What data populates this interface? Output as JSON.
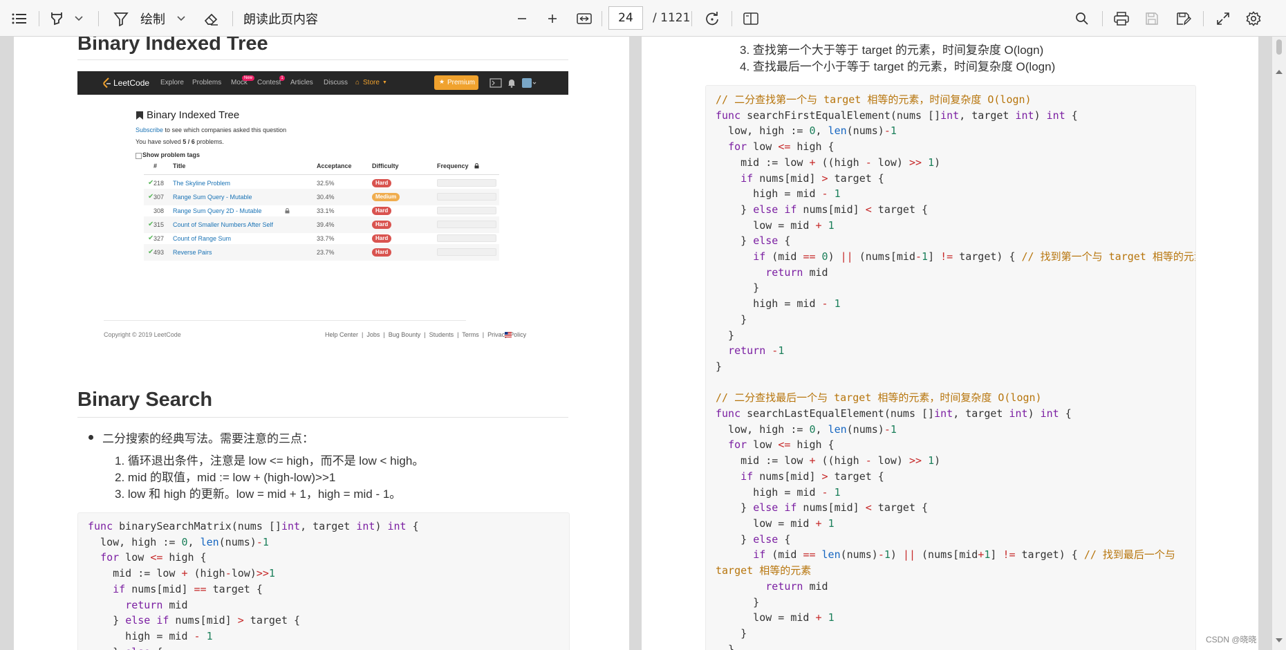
{
  "toolbar": {
    "draw_label": "绘制",
    "read_aloud_label": "朗读此页内容",
    "current_page": "24",
    "total_pages": "/ 1121"
  },
  "left_page": {
    "heading_bit": "Binary Indexed Tree",
    "leetcode": {
      "logo": "LeetCode",
      "nav": [
        "Explore",
        "Problems",
        "Mock",
        "Contest",
        "Articles",
        "Discuss",
        "Store"
      ],
      "mock_badge": "New",
      "contest_badge": "1",
      "premium": "Premium",
      "tag_title": "Binary Indexed Tree",
      "subscribe_link": "Subscribe",
      "subscribe_rest": "to see which companies asked this question",
      "solved_prefix": "You have solved",
      "solved_count": "5 / 6",
      "solved_suffix": "problems.",
      "show_tags": "Show problem tags",
      "columns": [
        "#",
        "Title",
        "Acceptance",
        "Difficulty",
        "Frequency"
      ],
      "rows": [
        {
          "solved": true,
          "num": "218",
          "title": "The Skyline Problem",
          "acceptance": "32.5%",
          "difficulty": "Hard",
          "color": "#d9534f"
        },
        {
          "solved": true,
          "num": "307",
          "title": "Range Sum Query - Mutable",
          "acceptance": "30.4%",
          "difficulty": "Medium",
          "color": "#f0ad4e"
        },
        {
          "solved": false,
          "num": "308",
          "title": "Range Sum Query 2D - Mutable",
          "acceptance": "33.1%",
          "difficulty": "Hard",
          "color": "#d9534f"
        },
        {
          "solved": true,
          "num": "315",
          "title": "Count of Smaller Numbers After Self",
          "acceptance": "39.4%",
          "difficulty": "Hard",
          "color": "#d9534f"
        },
        {
          "solved": true,
          "num": "327",
          "title": "Count of Range Sum",
          "acceptance": "33.7%",
          "difficulty": "Hard",
          "color": "#d9534f"
        },
        {
          "solved": true,
          "num": "493",
          "title": "Reverse Pairs",
          "acceptance": "23.7%",
          "difficulty": "Hard",
          "color": "#d9534f"
        }
      ],
      "copyright": "Copyright © 2019 LeetCode",
      "footer_links": "Help Center  |  Jobs  |  Bug Bounty  |  Students  |  Terms  |  Privacy Policy"
    },
    "heading_bs": "Binary Search",
    "bullet": "二分搜索的经典写法。需要注意的三点：",
    "points": [
      "1.  循环退出条件，注意是 low <= high，而不是 low < high。",
      "2.  mid 的取值，mid := low + (high-low)>>1",
      "3.  low 和 high 的更新。low = mid + 1，high = mid - 1。"
    ]
  },
  "right_page": {
    "points": [
      "3.  查找第一个大于等于 target 的元素，时间复杂度 O(logn)",
      "4.  查找最后一个小于等于 target 的元素，时间复杂度 O(logn)"
    ]
  },
  "watermark": "CSDN @晓晓"
}
